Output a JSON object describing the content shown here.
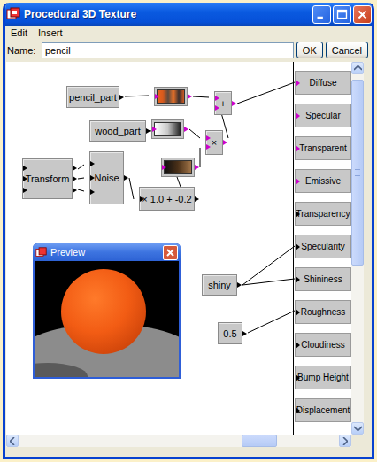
{
  "window": {
    "title": "Procedural 3D Texture"
  },
  "menu": [
    "Edit",
    "Insert"
  ],
  "name_field": {
    "label": "Name:",
    "value": "pencil"
  },
  "buttons": [
    "OK",
    "Cancel"
  ],
  "nodes": [
    {
      "kind": "block",
      "label": "pencil_part",
      "in": 0,
      "out": 1,
      "color": "#000000"
    },
    {
      "kind": "gradient",
      "stops": [
        "#e8641e",
        "#d85a1c",
        "#5a4a40",
        "#e87028",
        "#3a3030",
        "#d05a20"
      ],
      "in": 1,
      "out": 1,
      "color": "#cc00cc"
    },
    {
      "kind": "block",
      "label": "wood_part",
      "in": 0,
      "out": 1,
      "color": "#000000"
    },
    {
      "kind": "gradient",
      "stops": [
        "#ffffff",
        "#c8c8c8",
        "#202020"
      ],
      "in": 1,
      "out": 1,
      "color": "#cc00cc"
    },
    {
      "kind": "gradient",
      "stops": [
        "#101010",
        "#4a3018",
        "#a07448"
      ],
      "in": 1,
      "out": 1,
      "color": "#cc00cc"
    },
    {
      "kind": "block",
      "label": "+",
      "in": 2,
      "out": 1,
      "color": "#cc00cc"
    },
    {
      "kind": "block",
      "label": "×",
      "in": 2,
      "out": 1,
      "color": "#cc00cc"
    },
    {
      "kind": "block",
      "label": "Transform",
      "in": 3,
      "out": 3,
      "color": "#000000"
    },
    {
      "kind": "block",
      "label": "Noise",
      "in": 3,
      "out": 1,
      "color": "#000000"
    },
    {
      "kind": "block",
      "label": "× 1.0 + -0.2",
      "in": 1,
      "out": 1,
      "color": "#000000"
    },
    {
      "kind": "block",
      "label": "shiny",
      "in": 0,
      "out": 1,
      "color": "#000000"
    },
    {
      "kind": "block",
      "label": "0.5",
      "in": 0,
      "out": 1,
      "color": "#000000"
    }
  ],
  "outputs": [
    {
      "label": "Diffuse",
      "kind": "color"
    },
    {
      "label": "Specular",
      "kind": "color"
    },
    {
      "label": "Transparent",
      "kind": "color"
    },
    {
      "label": "Emissive",
      "kind": "color"
    },
    {
      "label": "Transparency",
      "kind": "value"
    },
    {
      "label": "Specularity",
      "kind": "value"
    },
    {
      "label": "Shininess",
      "kind": "value"
    },
    {
      "label": "Roughness",
      "kind": "value"
    },
    {
      "label": "Cloudiness",
      "kind": "value"
    },
    {
      "label": "Bump Height",
      "kind": "value"
    },
    {
      "label": "Displacement",
      "kind": "value"
    }
  ],
  "preview": {
    "title": "Preview"
  }
}
